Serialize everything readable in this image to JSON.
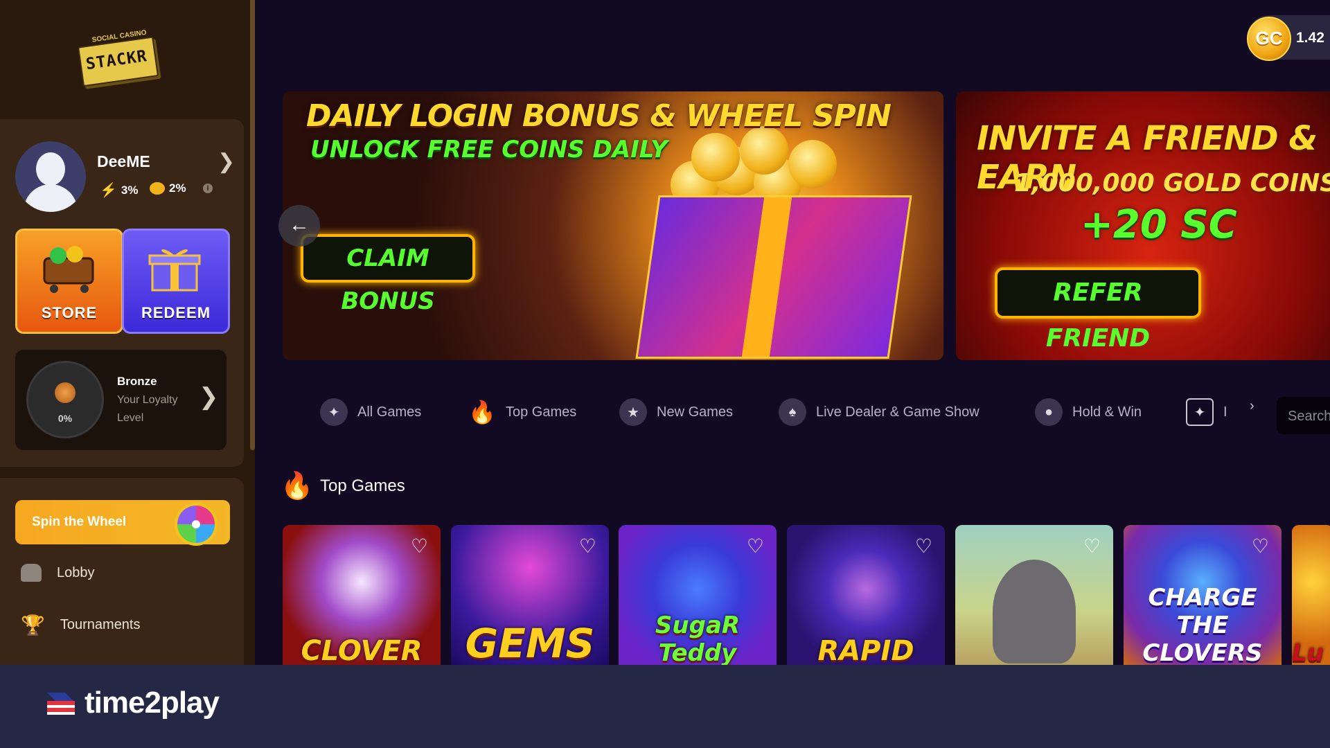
{
  "sidebar": {
    "logo_text": "STACKR",
    "logo_sub": "SOCIAL CASINO",
    "profile": {
      "username": "DeeME",
      "stat1": "3%",
      "stat2": "2%"
    },
    "store_label": "STORE",
    "redeem_label": "REDEEM",
    "loyalty": {
      "tier": "Bronze",
      "desc": "Your Loyalty Level",
      "progress": "0%"
    },
    "spin_label": "Spin the Wheel",
    "nav": [
      {
        "label": "Lobby"
      },
      {
        "label": "Tournaments"
      }
    ]
  },
  "header": {
    "coin_code": "GC",
    "balance": "1.42"
  },
  "banners": [
    {
      "title": "DAILY LOGIN BONUS & WHEEL SPIN",
      "subtitle": "UNLOCK FREE COINS DAILY",
      "cta": "CLAIM BONUS"
    },
    {
      "title": "INVITE A FRIEND & EARN",
      "line1": "1,000,000 GOLD COINS",
      "line2": "+20 SC",
      "cta": "REFER FRIEND"
    }
  ],
  "categories": [
    {
      "label": "All Games",
      "icon": "all-games-icon"
    },
    {
      "label": "Top Games",
      "icon": "flame-icon"
    },
    {
      "label": "New Games",
      "icon": "star-icon"
    },
    {
      "label": "Live Dealer & Game Show",
      "icon": "live-dealer-icon"
    },
    {
      "label": "Hold & Win",
      "icon": "hold-win-icon"
    },
    {
      "label": "I",
      "icon": "trident-icon"
    }
  ],
  "search": {
    "placeholder": "Search"
  },
  "section": {
    "title": "Top Games"
  },
  "games": [
    {
      "title": "CLOVER",
      "bg": "#8a1010"
    },
    {
      "title": "GEMS",
      "bg": "#3a1a9c"
    },
    {
      "title": "SugaR Teddy",
      "bg": "#6a24c8"
    },
    {
      "title": "RAPID",
      "bg": "#2a1470"
    },
    {
      "title": "",
      "bg": "#c9d48a"
    },
    {
      "title": "CHARGE THE CLOVERS",
      "bg": "#7a2aa8"
    },
    {
      "title": "Lu",
      "bg": "#d46a10"
    }
  ],
  "footer": {
    "brand": "time2play"
  }
}
